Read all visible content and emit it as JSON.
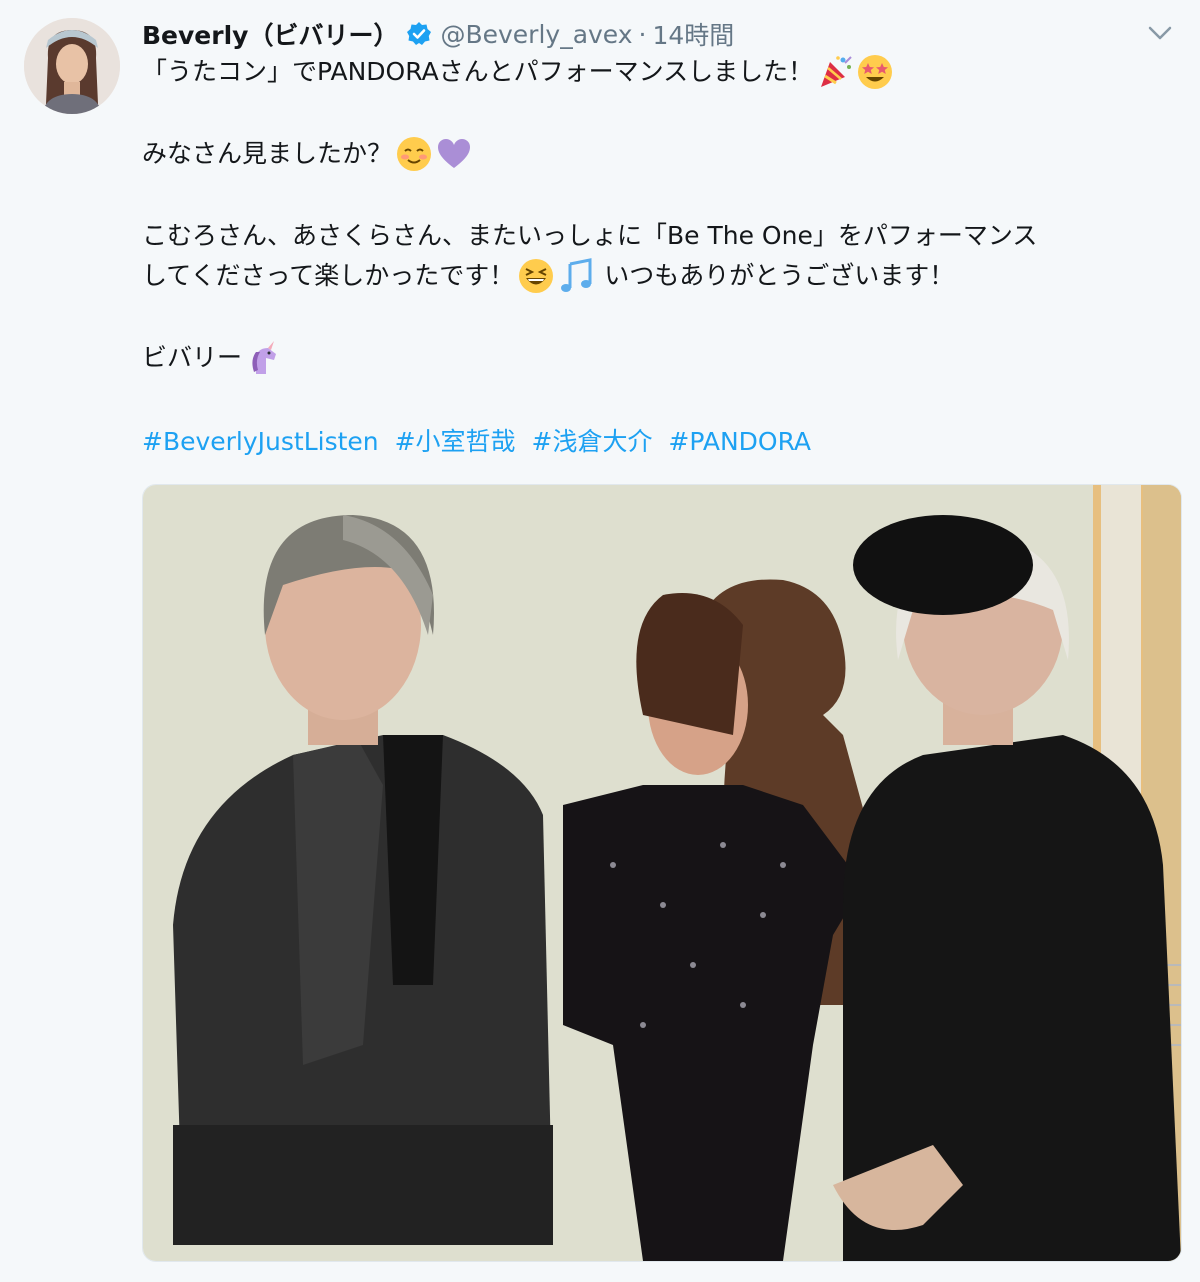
{
  "tweet": {
    "author_name": "Beverly（ビバリー）",
    "handle": "@Beverly_avex",
    "separator": "·",
    "timestamp": "14時間",
    "lines": {
      "l1": "「うたコン」でPANDORAさんとパフォーマンスしました！",
      "l2": "みなさん見ましたか？",
      "l3": "こむろさん、あさくらさん、またいっしょに「Be The One」をパフォーマンス",
      "l4a": "してくださって楽しかったです！",
      "l4b": "いつもありがとうございます！",
      "l5": "ビバリー"
    },
    "hashtags": [
      "#BeverlyJustListen",
      "#小室哲哉",
      "#浅倉大介",
      "#PANDORA"
    ],
    "icons": {
      "verified": "verified-badge-icon",
      "menu": "chevron-down-icon",
      "emojis": [
        "party-popper-emoji",
        "star-struck-emoji",
        "smiling-face-emoji",
        "purple-heart-emoji",
        "grinning-squinting-face-emoji",
        "musical-note-emoji",
        "unicorn-emoji"
      ]
    },
    "colors": {
      "link": "#1da1f2",
      "name": "#14171a",
      "meta": "#657786",
      "background": "#f5f8fa"
    }
  }
}
